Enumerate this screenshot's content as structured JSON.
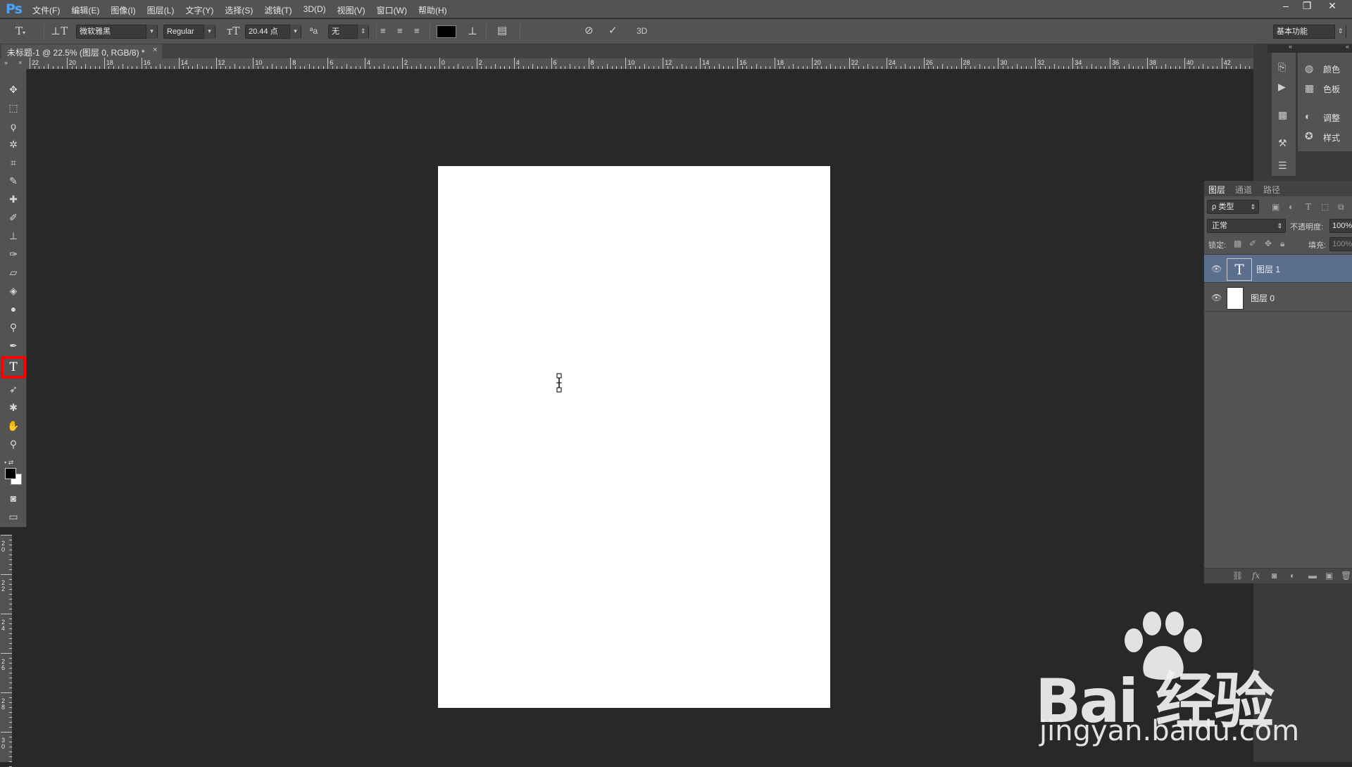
{
  "app": {
    "logo": "Ps",
    "menu": [
      "文件(F)",
      "编辑(E)",
      "图像(I)",
      "图层(L)",
      "文字(Y)",
      "选择(S)",
      "滤镜(T)",
      "3D(D)",
      "视图(V)",
      "窗口(W)",
      "帮助(H)"
    ],
    "window_buttons": {
      "minimize": "–",
      "restore": "❐",
      "close": "✕"
    }
  },
  "options_bar": {
    "font_family": "微软雅黑",
    "font_style": "Regular",
    "font_size": "20.44 点",
    "aa_label": "ªa",
    "anti_alias": "无",
    "text_color": "#000000",
    "label_3d": "3D",
    "workspace": "基本功能"
  },
  "document": {
    "tab_title": "未标题-1 @ 22.5% (图层 0, RGB/8) *",
    "close": "×"
  },
  "ruler_h": {
    "labels": [
      "22",
      "20",
      "18",
      "16",
      "14",
      "12",
      "10",
      "8",
      "6",
      "4",
      "2",
      "0",
      "2",
      "4",
      "6",
      "8",
      "10",
      "12",
      "14",
      "16",
      "18",
      "20",
      "22",
      "24",
      "26",
      "28",
      "30",
      "32",
      "34",
      "36",
      "38",
      "40",
      "42"
    ]
  },
  "ruler_v": {
    "labels": [
      "2 0",
      "2 2",
      "2 4",
      "2 6",
      "2 8",
      "3 0"
    ]
  },
  "toolbox": {
    "active_tool": "text-tool",
    "highlight_color": "#ff0000"
  },
  "mini_panels": {
    "color": "颜色",
    "swatches": "色板",
    "adjustments": "调整",
    "styles": "样式"
  },
  "layers_panel": {
    "tabs": [
      "图层",
      "通道",
      "路径"
    ],
    "filter_kind": "ρ 类型",
    "blend_mode": "正常",
    "opacity_label": "不透明度:",
    "opacity_value": "100%",
    "lock_label": "锁定:",
    "fill_label": "填充:",
    "fill_value": "100%",
    "layers": [
      {
        "name": "图层 1",
        "type": "text",
        "thumb": "T",
        "selected": true
      },
      {
        "name": "图层 0",
        "type": "pixel",
        "thumb": "",
        "selected": false
      }
    ]
  },
  "watermark": {
    "brand": "Bai 经验",
    "url": "jingyan.baidu.com"
  }
}
